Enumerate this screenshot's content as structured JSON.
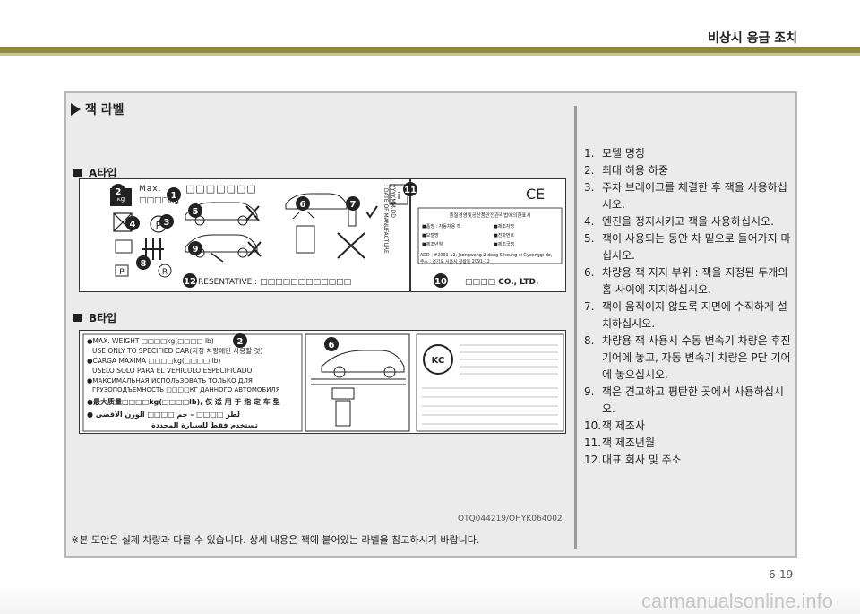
{
  "header": {
    "title": "비상시 응급 조치"
  },
  "section": {
    "title": "잭 라벨"
  },
  "type_a": {
    "label": "A타입",
    "max_text": "Max.",
    "boxes_top": "□□□□□□□",
    "kg_text": "□□□□kg",
    "kg_icon": "kg",
    "rep_text": "RESENTATIVE : □□□□□□□□□□□□",
    "date_text": ": DATE OF MANUFACTURE",
    "date_sub": "YYYY.MM.DD",
    "company_text": "□□□□  CO., LTD.",
    "ce_mark": "CE",
    "info_mark": "i",
    "addr_text": "ADD : #2091-12, Jeongwang 2-dong Siheung-si Gyeonggi-do,",
    "addr_kr": "주소 : 경기도 시흥시 정왕동 2091-12",
    "info_title": "품질경영및공산품안전관리법에의한표시",
    "info_row1_a": "■품명 : 자동차용 잭",
    "info_row1_b": "■제조자명",
    "info_row2_a": "■모델명",
    "info_row2_b": "■전화번호",
    "info_row3_a": "■제조년월",
    "info_row3_b": "■제조국명",
    "markers": [
      "2",
      "1",
      "4",
      "3",
      "5",
      "6",
      "7",
      "8",
      "9",
      "11",
      "10",
      "12"
    ]
  },
  "type_b": {
    "label": "B타입",
    "line1": "●MAX. WEIGHT □□□□kg(□□□□ lb)",
    "line2": "USE ONLY TO SPECIFIED CAR(지정 차량에만 사용할 것)",
    "line3": "●CARGA MAXIMA □□□□kg(□□□□ lb)",
    "line4": "USELO SOLO PARA EL VEHICULO ESPECIFICADO",
    "line5": "●МАКСИМАЛЬНАЯ ИСПОЛЬЗОВАТЬ ТОЛЬКО ДЛЯ",
    "line6": "ГРУЗОПОДЪЕМНОСТЬ □□□□КГ ДАННОГО АВТОМОБИЛЯ",
    "line7": "●最大质量□□□□kg(□□□□lb), 仅 适 用 于 指 定 车 型",
    "line8": "● لطر □□□□ – جم □□□□ الوزن الأقصى",
    "line9": "تستخدم فقط للسيارة المحددة",
    "kc_mark": "KC",
    "markers": [
      "2",
      "6"
    ]
  },
  "code": "OTQ044219/OHYK064002",
  "note": "※본 도안은 실제 차량과 다를 수 있습니다. 상세 내용은 잭에 붙어있는 라벨을 참고하시기 바랍니다.",
  "list": [
    {
      "num": "1.",
      "text": "모델 명칭"
    },
    {
      "num": "2.",
      "text": "최대 허용 하중"
    },
    {
      "num": "3.",
      "text": "주차 브레이크를 체결한 후 잭을 사용하십시오."
    },
    {
      "num": "4.",
      "text": "엔진을 정지시키고 잭을 사용하십시오."
    },
    {
      "num": "5.",
      "text": "잭이 사용되는 동안 차 밑으로 들어가지 마십시오."
    },
    {
      "num": "6.",
      "text": "차량용 잭 지지 부위 : 잭을 지정된 두개의 홈 사이에 지지하십시오."
    },
    {
      "num": "7.",
      "text": "잭이 움직이지 않도록 지면에 수직하게 설치하십시오."
    },
    {
      "num": "8.",
      "text": "차량용 잭 사용시 수동 변속기 차량은 후진 기어에 놓고, 자동 변속기 차량은 P단 기어에 놓으십시오."
    },
    {
      "num": "9.",
      "text": "잭은 견고하고 평탄한 곳에서 사용하십시오."
    },
    {
      "num": "10.",
      "text": "잭 제조사"
    },
    {
      "num": "11.",
      "text": "잭 제조년월"
    },
    {
      "num": "12.",
      "text": "대표 회사 및 주소"
    }
  ],
  "page": {
    "number": "6-19"
  },
  "watermark": "carmanualsonline.info"
}
